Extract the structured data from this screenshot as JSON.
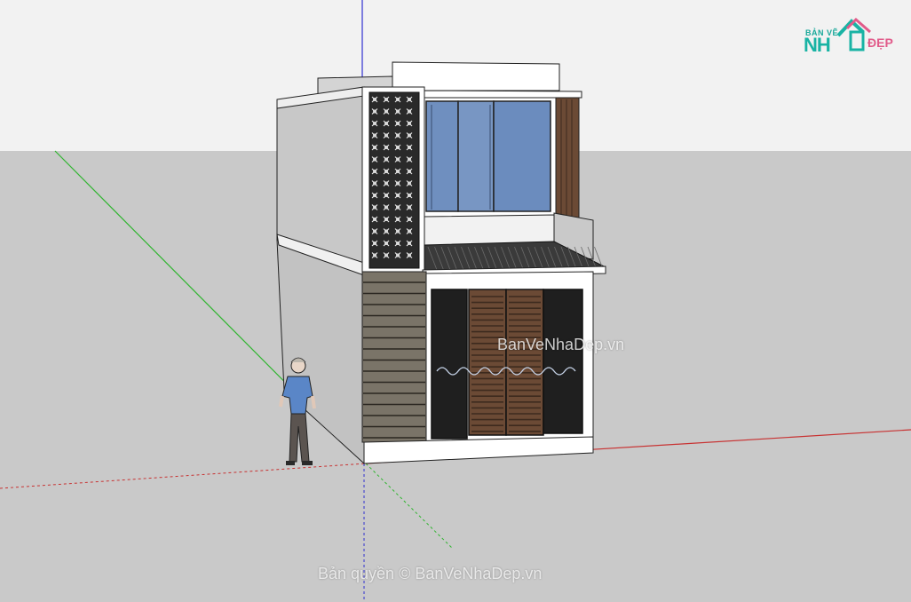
{
  "app": {
    "type": "3d-modeling-viewport"
  },
  "colors": {
    "sky": "#f2f2f2",
    "ground": "#c9c9c9",
    "axis_green": "#2fb52f",
    "axis_red": "#c83232",
    "axis_blue": "#3030d0",
    "wall_shadow": "#c6c6c6",
    "wall_white": "#ffffff",
    "glass": "#6f8fbf",
    "wood": "#6b4a35",
    "stone": "#7a7468"
  },
  "logo": {
    "small_text": "BẢN VẼ",
    "big_text": "NH",
    "accent_text": "ĐẸP"
  },
  "watermarks": {
    "center": "BanVeNhaDep.vn",
    "bottom": "Bản quyền © BanVeNhaDep.vn"
  },
  "objects": {
    "building": "two-storey-townhouse-model",
    "figure": "human-scale-figure"
  }
}
